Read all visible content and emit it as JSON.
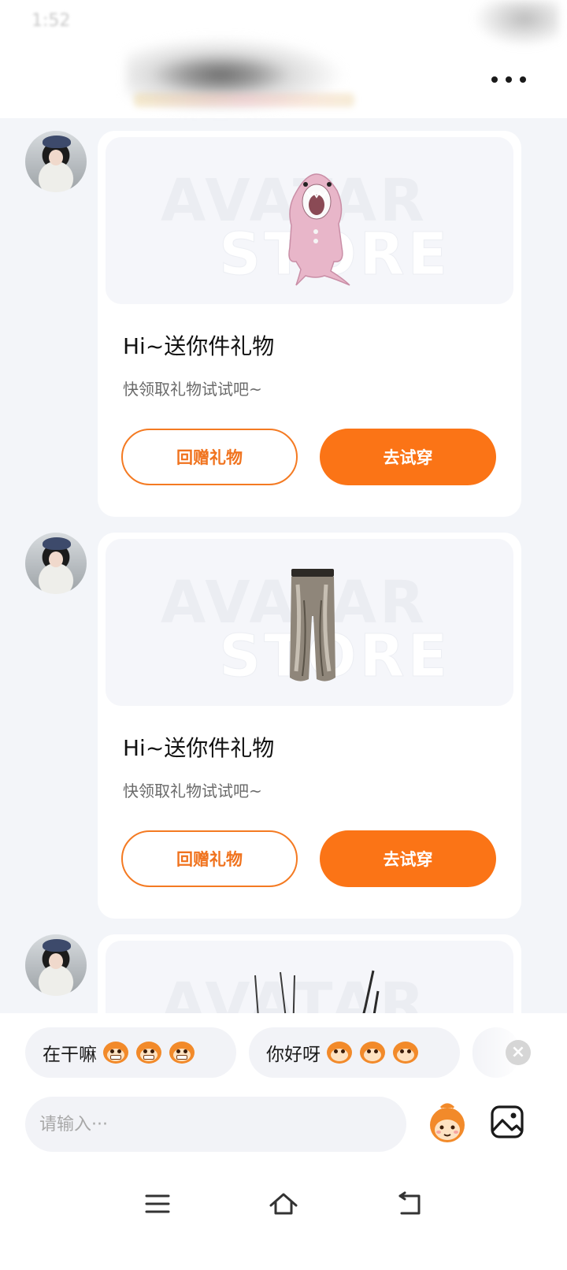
{
  "status_bar": {
    "time": "1:52"
  },
  "header": {
    "more_icon": "more-horizontal-icon"
  },
  "messages": [
    {
      "item_icon": "shark-hoodie-image",
      "watermark_line1": "AVATAR",
      "watermark_line2": "STORE",
      "title": "Hi~送你件礼物",
      "subtitle": "快领取礼物试试吧~",
      "return_gift_label": "回赠礼物",
      "try_on_label": "去试穿"
    },
    {
      "item_icon": "pants-image",
      "watermark_line1": "AVATAR",
      "watermark_line2": "STORE",
      "title": "Hi~送你件礼物",
      "subtitle": "快领取礼物试试吧~",
      "return_gift_label": "回赠礼物",
      "try_on_label": "去试穿"
    },
    {
      "item_icon": "gift-item-image",
      "watermark_line1": "AVATAR"
    }
  ],
  "quick_replies": [
    {
      "label": "在干嘛"
    },
    {
      "label": "你好呀"
    }
  ],
  "input": {
    "placeholder": "请输入···"
  },
  "colors": {
    "accent": "#fb7416",
    "outline": "#f47a22",
    "background": "#f3f5f9"
  }
}
